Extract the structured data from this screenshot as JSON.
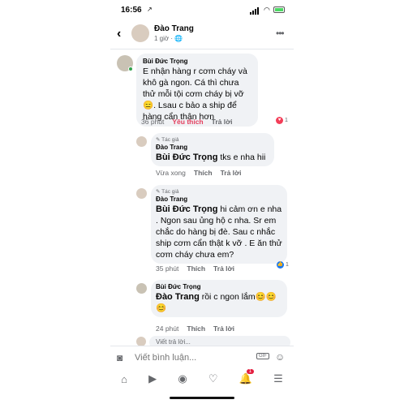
{
  "status": {
    "time": "16:56",
    "location": "↗"
  },
  "header": {
    "back": "‹",
    "name": "Đào Trang",
    "time": "1 giờ · ",
    "globe": "🌐",
    "more": "•••"
  },
  "comments": [
    {
      "author": "Bùi Đức Trọng",
      "text": "E nhận hàng r cơm cháy và khô gà ngon. Cá thì chưa thử mỗi tội cơm cháy bị vỡ 😑. Lsau c bảo a ship để hàng cẩn thận hơn",
      "time": "36 phút",
      "like": "Yêu thích",
      "reply": "Trả lời",
      "reaction_count": "1"
    }
  ],
  "replies": [
    {
      "badge": "✎ Tác giả",
      "author": "Đào Trang",
      "mention": "Bùi Đức Trọng",
      "text": " tks e nha hii",
      "time": "Vừa xong",
      "like": "Thích",
      "reply": "Trả lời"
    },
    {
      "badge": "✎ Tác giả",
      "author": "Đào Trang",
      "mention": "Bùi Đức Trọng",
      "text": "  hi cảm ơn e nha . Ngon sau ủng hộ c nha. Sr em chắc do hàng bị đè. Sau c nhắc ship cơm cẩn thật k vỡ . E ăn thử cơm cháy chưa em?",
      "time": "35 phút",
      "like": "Thích",
      "reply": "Trả lời",
      "reaction_count": "1"
    },
    {
      "author": "Bùi Đức Trọng",
      "mention": "Đào Trang",
      "text": " rồi c ngon lắm😊😊😊",
      "time": "24 phút",
      "like": "Thích",
      "reply": "Trả lời"
    }
  ],
  "reply_box": {
    "placeholder": "Viết trả lời..."
  },
  "composer": {
    "placeholder": "Viết bình luận...",
    "gif": "GIF"
  },
  "tabbar": {
    "notifications_count": "1"
  }
}
